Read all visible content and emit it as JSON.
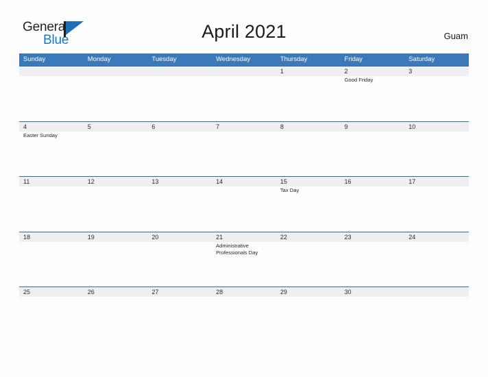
{
  "brand": {
    "name_part1": "General",
    "name_part2": "Blue",
    "flag_icon": "flag-triangle-icon",
    "color_dark": "#231f20",
    "color_blue": "#1878c8"
  },
  "header": {
    "title": "April 2021",
    "region": "Guam"
  },
  "calendar": {
    "header_color": "#3b79b8",
    "band_color": "#efefef",
    "line_color": "#2b6ca8",
    "weekdays": [
      "Sunday",
      "Monday",
      "Tuesday",
      "Wednesday",
      "Thursday",
      "Friday",
      "Saturday"
    ],
    "weeks": [
      [
        {
          "day": "",
          "events": []
        },
        {
          "day": "",
          "events": []
        },
        {
          "day": "",
          "events": []
        },
        {
          "day": "",
          "events": []
        },
        {
          "day": "1",
          "events": []
        },
        {
          "day": "2",
          "events": [
            "Good Friday"
          ]
        },
        {
          "day": "3",
          "events": []
        }
      ],
      [
        {
          "day": "4",
          "events": [
            "Easter Sunday"
          ]
        },
        {
          "day": "5",
          "events": []
        },
        {
          "day": "6",
          "events": []
        },
        {
          "day": "7",
          "events": []
        },
        {
          "day": "8",
          "events": []
        },
        {
          "day": "9",
          "events": []
        },
        {
          "day": "10",
          "events": []
        }
      ],
      [
        {
          "day": "11",
          "events": []
        },
        {
          "day": "12",
          "events": []
        },
        {
          "day": "13",
          "events": []
        },
        {
          "day": "14",
          "events": []
        },
        {
          "day": "15",
          "events": [
            "Tax Day"
          ]
        },
        {
          "day": "16",
          "events": []
        },
        {
          "day": "17",
          "events": []
        }
      ],
      [
        {
          "day": "18",
          "events": []
        },
        {
          "day": "19",
          "events": []
        },
        {
          "day": "20",
          "events": []
        },
        {
          "day": "21",
          "events": [
            "Administrative Professionals Day"
          ]
        },
        {
          "day": "22",
          "events": []
        },
        {
          "day": "23",
          "events": []
        },
        {
          "day": "24",
          "events": []
        }
      ],
      [
        {
          "day": "25",
          "events": []
        },
        {
          "day": "26",
          "events": []
        },
        {
          "day": "27",
          "events": []
        },
        {
          "day": "28",
          "events": []
        },
        {
          "day": "29",
          "events": []
        },
        {
          "day": "30",
          "events": []
        },
        {
          "day": "",
          "events": []
        }
      ]
    ]
  }
}
